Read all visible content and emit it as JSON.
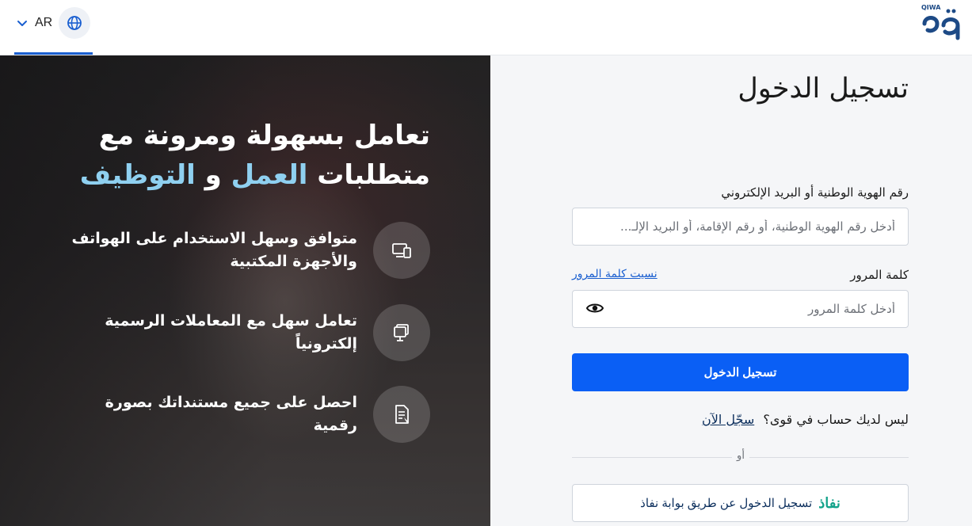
{
  "header": {
    "language_code": "AR",
    "icons": {
      "chevron": "chevron-down-icon",
      "globe": "globe-icon",
      "logo": "qiwa-logo"
    },
    "logo_text": "QIWA",
    "colors": {
      "accent": "#1a5fd0",
      "logo": "#1d4a86"
    }
  },
  "hero": {
    "title_part1": "تعامل بسهولة ومرونة مع متطلبات",
    "title_accent1": "العمل",
    "title_connector": "و",
    "title_accent2": "التوظيف",
    "features": [
      {
        "icon": "devices-icon",
        "text": "متوافق وسهل الاستخدام على الهواتف والأجهزة المكتبية"
      },
      {
        "icon": "computer-icon",
        "text": "تعامل سهل مع المعاملات الرسمية إلكترونياً"
      },
      {
        "icon": "document-icon",
        "text": "احصل على جميع مستنداتك بصورة رقمية"
      }
    ],
    "colors": {
      "accent_text": "#8fd0f0"
    }
  },
  "login": {
    "title": "تسجيل الدخول",
    "id_label": "رقم الهوية الوطنية أو البريد الإلكتروني",
    "id_placeholder": "أدخل رقم الهوية الوطنية، أو رقم الإقامة، أو البريد الإلـ...",
    "password_label": "كلمة المرور",
    "forgot_password": "نسيت كلمة المرور",
    "password_placeholder": "أدخل كلمة المرور",
    "submit_label": "تسجيل الدخول",
    "no_account_text": "ليس لديك حساب في قوى؟",
    "register_link": "سجّل الآن",
    "or_text": "أو",
    "nafath_logo": "نفاذ",
    "nafath_label": "تسجيل الدخول عن طريق بوابة نفاذ",
    "colors": {
      "primary": "#0a5ff5",
      "nafath": "#14a38b"
    }
  }
}
